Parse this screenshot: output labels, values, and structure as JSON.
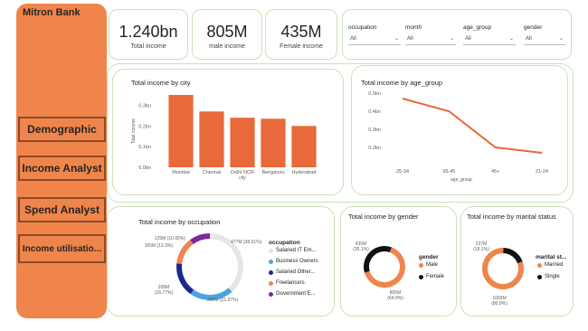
{
  "brand": "Mitron Bank",
  "colors": {
    "accent": "#F0854B",
    "bar": "#E8693A",
    "card_border": "#c9e3b8"
  },
  "nav": [
    {
      "label": "Demographic"
    },
    {
      "label": "Income Analyst"
    },
    {
      "label": "Spend Analyst"
    },
    {
      "label": "Income utilisatio..."
    }
  ],
  "kpis": [
    {
      "value": "1.240bn",
      "label": "Total income"
    },
    {
      "value": "805M",
      "label": "male income"
    },
    {
      "value": "435M",
      "label": "Female income"
    }
  ],
  "slicers": [
    {
      "title": "occupation",
      "value": "All"
    },
    {
      "title": "month",
      "value": "All"
    },
    {
      "title": "age_group",
      "value": "All"
    },
    {
      "title": "gender",
      "value": "All"
    }
  ],
  "chart_data": [
    {
      "type": "bar",
      "title": "Total income by city",
      "xlabel": "city",
      "ylabel": "Total income",
      "categories": [
        "Mumbai",
        "Chennai",
        "Delhi NCR",
        "Bengaluru",
        "Hyderabad"
      ],
      "values": [
        0.35,
        0.27,
        0.24,
        0.235,
        0.2
      ],
      "yticks": [
        "0.3bn",
        "0.2bn",
        "0.1bn",
        "0.0bn"
      ],
      "ylim": [
        0,
        0.35
      ]
    },
    {
      "type": "line",
      "title": "Total income by age_group",
      "xlabel": "age_group",
      "categories": [
        "25-34",
        "35-45",
        "45+",
        "21-24"
      ],
      "values": [
        0.47,
        0.4,
        0.2,
        0.17
      ],
      "yticks": [
        "0.5bn",
        "0.4bn",
        "0.3bn",
        "0.2bn"
      ],
      "ylim": [
        0.15,
        0.5
      ]
    },
    {
      "type": "pie",
      "title": "Total income by occupation",
      "legend_title": "occupation",
      "slices": [
        {
          "name": "Salaried IT Em...",
          "value": 477,
          "label": "477M (38.51%)",
          "color": "#E6E6E6"
        },
        {
          "name": "Business Owners",
          "value": 265,
          "label": "265M (21.37%)",
          "color": "#4DA3E0"
        },
        {
          "name": "Salaried Other...",
          "value": 208,
          "label": "208M (16.77%)",
          "color": "#1B2A8A"
        },
        {
          "name": "Freelancers",
          "value": 165,
          "label": "165M (13.3%)",
          "color": "#F0854B"
        },
        {
          "name": "Government E...",
          "value": 125,
          "label": "125M (10.05%)",
          "color": "#7B2A9B"
        }
      ]
    },
    {
      "type": "pie",
      "title": "Total income by gender",
      "legend_title": "gender",
      "slices": [
        {
          "name": "Male",
          "value": 805,
          "label": "805M (64.9%)",
          "color": "#F0854B"
        },
        {
          "name": "Female",
          "value": 435,
          "label": "435M (35.1%)",
          "color": "#111111"
        }
      ]
    },
    {
      "type": "pie",
      "title": "Total income by marital status",
      "legend_title": "marital st...",
      "slices": [
        {
          "name": "Married",
          "value": 1003,
          "label": "1003M (80.9%)",
          "color": "#F0854B"
        },
        {
          "name": "Single",
          "value": 237,
          "label": "237M (19.1%)",
          "color": "#111111"
        }
      ]
    }
  ]
}
